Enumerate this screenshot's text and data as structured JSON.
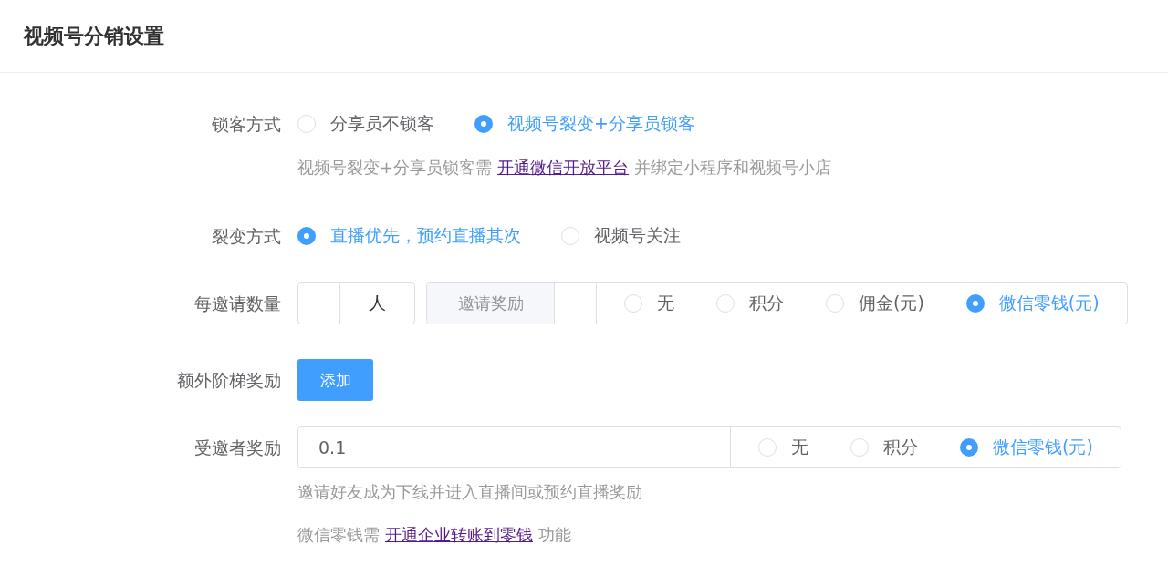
{
  "title": "视频号分销设置",
  "form": [
    {
      "kind": "radio",
      "label": "锁客方式",
      "options": [
        {
          "label": "分享员不锁客",
          "selected": false
        },
        {
          "label": "视频号裂变+分享员锁客",
          "selected": true
        }
      ],
      "hints": [
        {
          "text": "视频号裂变+分享员锁客需",
          "link": "开通微信开放平台",
          "after": "并绑定小程序和视频号小店"
        }
      ]
    },
    {
      "kind": "radio",
      "label": "裂变方式",
      "options": [
        {
          "label": "直播优先，预约直播其次",
          "selected": true
        },
        {
          "label": "视频号关注",
          "selected": false
        }
      ]
    },
    {
      "kind": "invite_count",
      "label": "每邀请数量",
      "suffix": "人",
      "prepend": "邀请奖励",
      "options": [
        {
          "label": "无",
          "selected": false
        },
        {
          "label": "积分",
          "selected": false
        },
        {
          "label": "佣金(元)",
          "selected": false
        },
        {
          "label": "微信零钱(元)",
          "selected": true
        }
      ]
    },
    {
      "kind": "button",
      "label": "额外阶梯奖励",
      "button": "添加"
    },
    {
      "kind": "invitee_reward",
      "label": "受邀者奖励",
      "value": "0.1",
      "options": [
        {
          "label": "无",
          "selected": false
        },
        {
          "label": "积分",
          "selected": false
        },
        {
          "label": "微信零钱(元)",
          "selected": true
        }
      ],
      "hints": [
        {
          "text": "邀请好友成为下线并进入直播间或预约直播奖励"
        },
        {
          "text": "微信零钱需",
          "link": "开通企业转账到零钱",
          "after": "功能"
        }
      ]
    }
  ]
}
